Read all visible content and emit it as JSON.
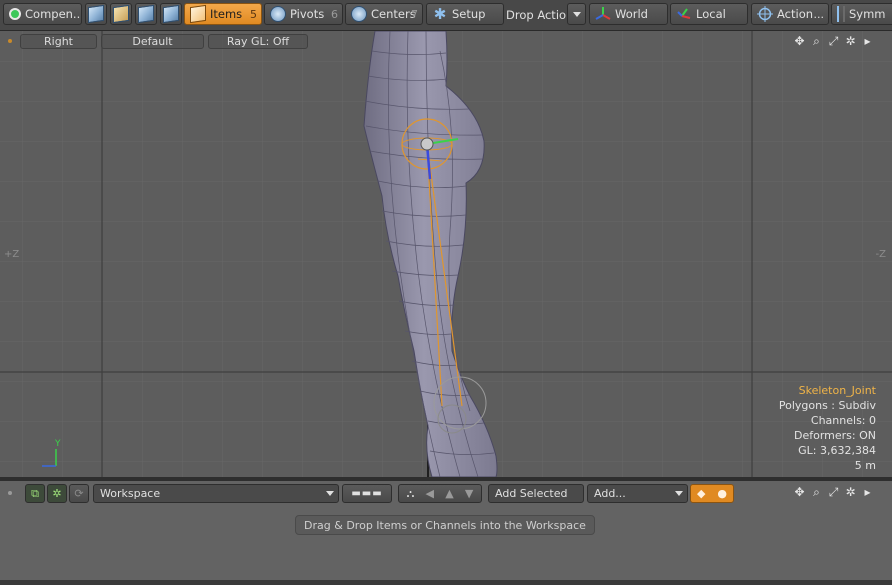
{
  "toolbar": {
    "components_label": "Compen...",
    "items": {
      "label": "Items",
      "count": "5"
    },
    "pivots": {
      "label": "Pivots",
      "count": "6"
    },
    "centers": {
      "label": "Centers",
      "count": "7"
    },
    "setup_label": "Setup",
    "drop_action_label": "Drop Action",
    "world_label": "World",
    "local_label": "Local",
    "action_label": "Action",
    "action_more": "...",
    "symmetry_label": "Symm",
    "icons": [
      "vertices-icon",
      "edges-icon",
      "polygons-icon",
      "materials-icon"
    ]
  },
  "viewport": {
    "view_label": "Right",
    "style_label": "Default",
    "raygl_label": "Ray GL: Off",
    "axis_left": "+Z",
    "axis_right": "-Z",
    "y_axis": "Y",
    "info": {
      "selection": "Skeleton_Joint",
      "polygons": "Polygons : Subdiv",
      "channels": "Channels: 0",
      "deformers": "Deformers: ON",
      "gl": "GL: 3,632,384",
      "distance": "5 m"
    },
    "colors": {
      "highlight": "#f0b448",
      "accent": "#e08a22"
    }
  },
  "workspace": {
    "selector_value": "Workspace",
    "add_selected_label": "Add Selected",
    "add_label": "Add...",
    "hint": "Drag & Drop Items or Channels into the Workspace"
  }
}
